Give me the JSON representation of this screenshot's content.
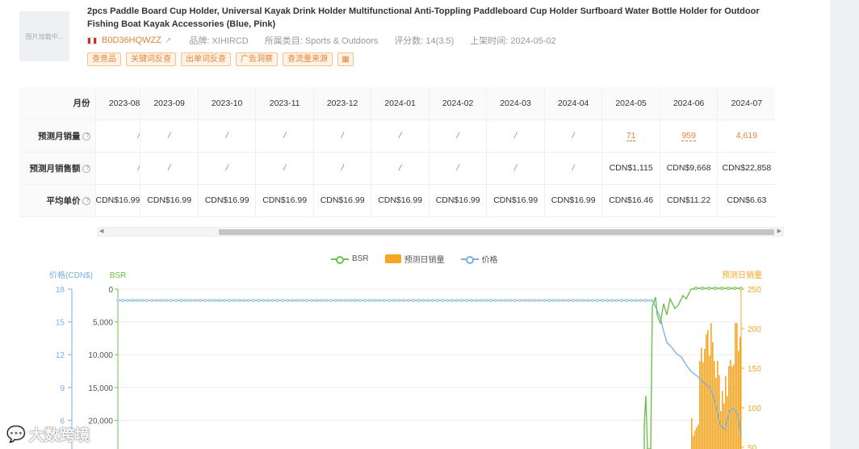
{
  "product": {
    "thumbnail_text": "图片加载中...",
    "title": "2pcs Paddle Board Cup Holder, Universal Kayak Drink Holder Multifunctional Anti-Toppling Paddleboard Cup Holder Surfboard Water Bottle Holder for Outdoor Fishing Boat Kayak Accessories (Blue, Pink)",
    "asin": "B0D36HQWZZ",
    "brand": "品牌: XIHIRCD",
    "category": "所属类目: Sports & Outdoors",
    "rating": "评分数: 14(3.5)",
    "listed": "上架时间: 2024-05-02"
  },
  "tags": [
    "查竞品",
    "关键词反查",
    "出单词反查",
    "广告洞察",
    "查流量来源"
  ],
  "table": {
    "header_label": "月份",
    "months": [
      "2023-08",
      "2023-09",
      "2023-10",
      "2023-11",
      "2023-12",
      "2024-01",
      "2024-02",
      "2024-03",
      "2024-04",
      "2024-05",
      "2024-06",
      "2024-07"
    ],
    "rows": [
      {
        "label": "预测月销量",
        "help": "?",
        "values": [
          "/",
          "/",
          "/",
          "/",
          "/",
          "/",
          "/",
          "/",
          "/",
          "71",
          "959",
          "4,619"
        ]
      },
      {
        "label": "预测月销售额",
        "help": "?",
        "values": [
          "/",
          "/",
          "/",
          "/",
          "/",
          "/",
          "/",
          "/",
          "/",
          "CDN$1,115",
          "CDN$9,668",
          "CDN$22,858"
        ]
      },
      {
        "label": "平均单价",
        "help": "?",
        "values": [
          "CDN$16.99",
          "CDN$16.99",
          "CDN$16.99",
          "CDN$16.99",
          "CDN$16.99",
          "CDN$16.99",
          "CDN$16.99",
          "CDN$16.99",
          "CDN$16.99",
          "CDN$16.46",
          "CDN$11.22",
          "CDN$6.63"
        ]
      }
    ]
  },
  "legend": {
    "bsr": "BSR",
    "daily": "预测日销量",
    "price": "价格"
  },
  "chart_data": {
    "type": "line",
    "axes": {
      "price": {
        "label": "价格(CDN$)",
        "ticks": [
          "18",
          "15",
          "12",
          "9",
          "6"
        ],
        "range": [
          6,
          18
        ]
      },
      "bsr": {
        "label": "BSR",
        "ticks": [
          "0",
          "5,000",
          "10,000",
          "15,000",
          "20,000"
        ],
        "range": [
          0,
          22000
        ],
        "inverted": true
      },
      "daily": {
        "label": "预测日销量",
        "ticks": [
          "250",
          "200",
          "150",
          "100",
          "50"
        ],
        "range": [
          40,
          250
        ]
      }
    },
    "colors": {
      "bsr": "#6cc24a",
      "daily": "#f5a623",
      "price": "#7ab0e0"
    }
  },
  "watermark": "大数跨境"
}
